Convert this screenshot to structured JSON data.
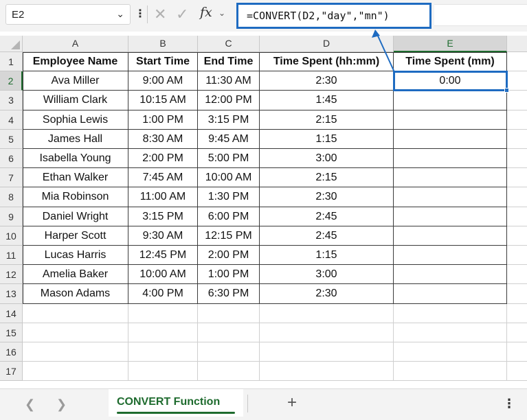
{
  "formula_bar": {
    "name_box": "E2",
    "formula": "=CONVERT(D2,\"day\",\"mn\")"
  },
  "columns": [
    "A",
    "B",
    "C",
    "D",
    "E"
  ],
  "rows": [
    "1",
    "2",
    "3",
    "4",
    "5",
    "6",
    "7",
    "8",
    "9",
    "10",
    "11",
    "12",
    "13",
    "14",
    "15",
    "16",
    "17"
  ],
  "table": {
    "headers": [
      "Employee Name",
      "Start Time",
      "End Time",
      "Time Spent (hh:mm)",
      "Time Spent (mm)"
    ],
    "rows": [
      [
        "Ava Miller",
        "9:00 AM",
        "11:30 AM",
        "2:30",
        "0:00"
      ],
      [
        "William Clark",
        "10:15 AM",
        "12:00 PM",
        "1:45",
        ""
      ],
      [
        "Sophia Lewis",
        "1:00 PM",
        "3:15 PM",
        "2:15",
        ""
      ],
      [
        "James Hall",
        "8:30 AM",
        "9:45 AM",
        "1:15",
        ""
      ],
      [
        "Isabella Young",
        "2:00 PM",
        "5:00 PM",
        "3:00",
        ""
      ],
      [
        "Ethan Walker",
        "7:45 AM",
        "10:00 AM",
        "2:15",
        ""
      ],
      [
        "Mia Robinson",
        "11:00 AM",
        "1:30 PM",
        "2:30",
        ""
      ],
      [
        "Daniel Wright",
        "3:15 PM",
        "6:00 PM",
        "2:45",
        ""
      ],
      [
        "Harper Scott",
        "9:30 AM",
        "12:15 PM",
        "2:45",
        ""
      ],
      [
        "Lucas Harris",
        "12:45 PM",
        "2:00 PM",
        "1:15",
        ""
      ],
      [
        "Amelia Baker",
        "10:00 AM",
        "1:00 PM",
        "3:00",
        ""
      ],
      [
        "Mason Adams",
        "4:00 PM",
        "6:30 PM",
        "2:30",
        ""
      ]
    ]
  },
  "selection": {
    "cell": "E2"
  },
  "sheet_tabs": {
    "active": "CONVERT Function"
  },
  "colors": {
    "accent_blue": "#1e6bc1",
    "excel_green": "#1e6b2e"
  },
  "icons": [
    "chevron-down-icon",
    "cancel-icon",
    "enter-icon",
    "function-icon",
    "prev-sheet-icon",
    "next-sheet-icon",
    "add-sheet-icon",
    "more-options-icon"
  ]
}
